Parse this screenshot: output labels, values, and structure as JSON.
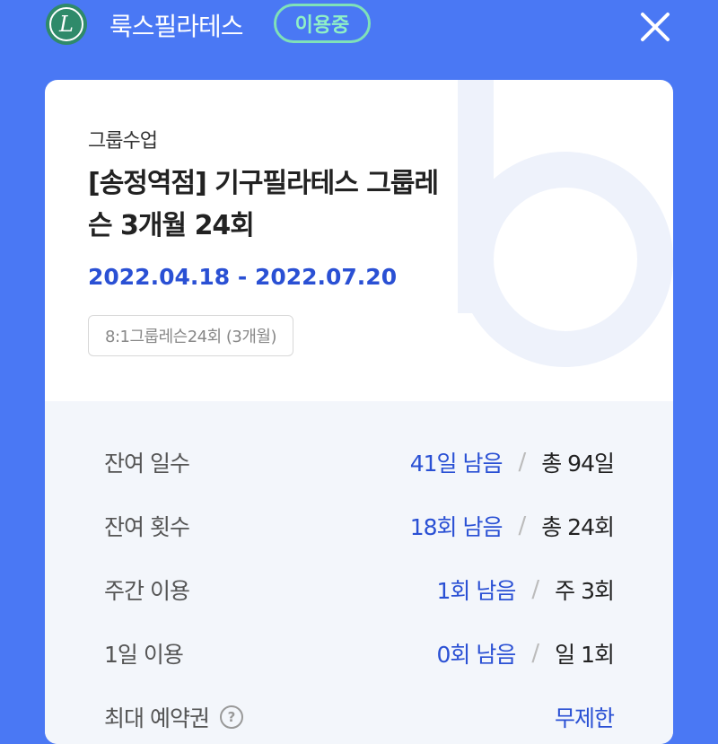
{
  "header": {
    "logo_letter": "L",
    "brand_name": "룩스필라테스",
    "status_badge": "이용중"
  },
  "membership": {
    "category": "그룹수업",
    "title_line1": "[송정역점] 기구필라테스 그룹레",
    "title_line2": "슨 3개월 24회",
    "period": "2022.04.18 - 2022.07.20",
    "tag": "8:1그룹레슨24회 (3개월)"
  },
  "stats": [
    {
      "label": "잔여 일수",
      "remain": "41일 남음",
      "total": "총 94일"
    },
    {
      "label": "잔여 횟수",
      "remain": "18회 남음",
      "total": "총 24회"
    },
    {
      "label": "주간 이용",
      "remain": "1회 남음",
      "total": "주 3회"
    },
    {
      "label": "1일 이용",
      "remain": "0회 남음",
      "total": "일 1회"
    },
    {
      "label": "최대 예약권",
      "remain": "무제한",
      "total": ""
    }
  ],
  "colors": {
    "background": "#4a78f4",
    "accent_blue": "#2a50d4",
    "badge_green": "#7fe1b8",
    "logo_green": "#2f8a6a"
  }
}
